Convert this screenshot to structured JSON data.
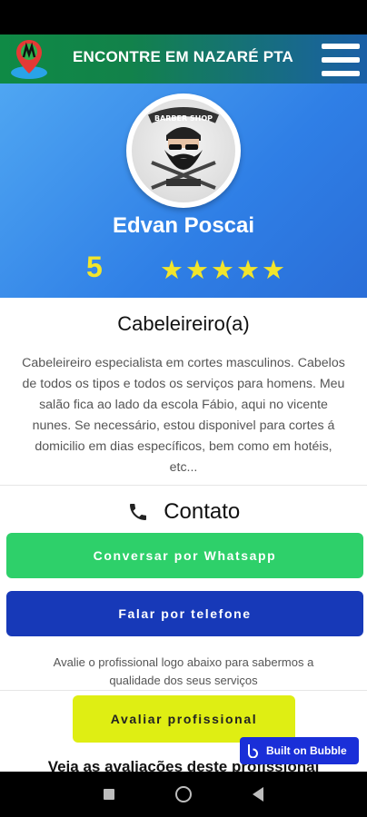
{
  "header": {
    "title": "ENCONTRE EM NAZARÉ PTA",
    "logo_icon": "map-pin-logo-icon",
    "menu_icon": "hamburger-menu-icon"
  },
  "profile": {
    "name": "Edvan Poscai",
    "rating": "5",
    "stars": "★★★★★",
    "avatar_badge_text": "BARBER SHOP"
  },
  "details": {
    "profession": "Cabeleireiro(a)",
    "description": "Cabeleireiro especialista em cortes masculinos. Cabelos de todos os tipos e todos os serviços para homens. Meu salão fica ao lado da escola Fábio, aqui no vicente nunes. Se necessário, estou disponivel para cortes á domicilio em dias específicos, bem como em hotéis, etc..."
  },
  "contact": {
    "title": "Contato",
    "whatsapp_label": "Conversar por Whatsapp",
    "phone_label": "Falar por telefone",
    "hint": "Avalie o profissional logo abaixo para sabermos a qualidade dos seus serviços",
    "rate_label": "Avaliar profissional",
    "reviews_title": "Veja as avaliações deste profissional"
  },
  "badge": {
    "label": "Built on Bubble"
  },
  "colors": {
    "whatsapp": "#2ed06a",
    "phone": "#1739b8",
    "rate": "#dfee13",
    "stars": "#f2e52b",
    "hero": "#3b8ef0"
  }
}
